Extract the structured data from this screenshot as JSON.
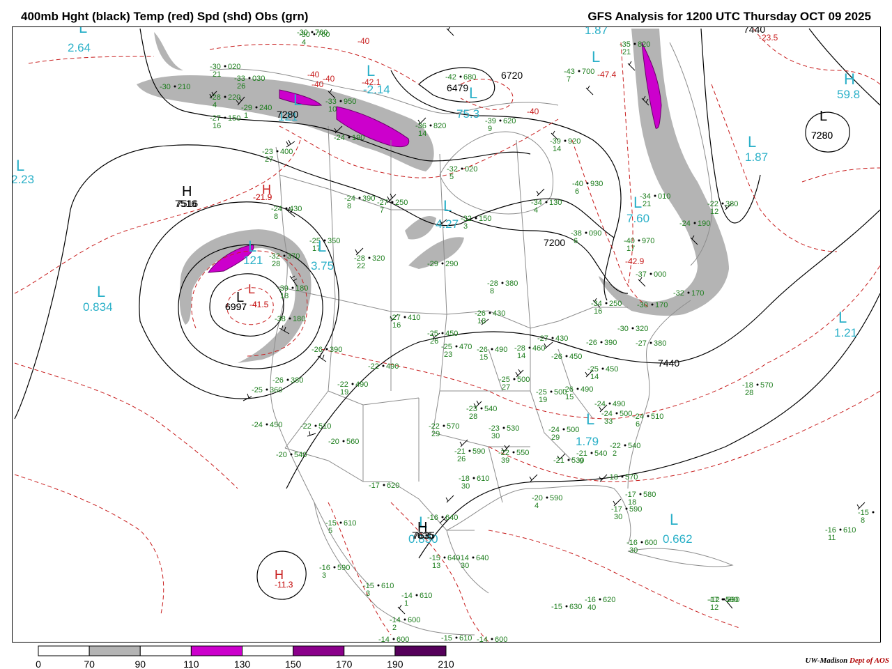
{
  "header": {
    "left_title": "400mb Hght (black) Temp (red) Spd (shd) Obs (grn)",
    "right_title": "GFS Analysis for 1200 UTC Thursday  OCT 09 2025"
  },
  "colors": {
    "height": "#000000",
    "temperature": "#c81e1e",
    "observations": "#1c7d1c",
    "pressure_centers": "#2ab0c8",
    "speed_70_90": "#b4b4b4",
    "speed_110_130": "#cc00cc",
    "speed_150_170": "#8a008a",
    "speed_190_210": "#55005a",
    "borders": "#8c8c8c"
  },
  "scale": {
    "labels": [
      "0",
      "70",
      "90",
      "110",
      "130",
      "150",
      "170",
      "190",
      "210"
    ]
  },
  "credit": {
    "org": "UW-Madison",
    "dept": "Dept of AOS"
  },
  "height_labels": [
    "7516",
    "7280",
    "6720",
    "7280",
    "6479",
    "7200",
    "6997",
    "7440",
    "7635",
    "7440"
  ],
  "temperature_labels": [
    "-40",
    "-40",
    "-40",
    "-40",
    "-40",
    "-21.9",
    "-41.5",
    "-47.4",
    "-42.9",
    "-11.3",
    "-23.5",
    "-42.1"
  ],
  "cyan_centers": [
    {
      "letter": "L",
      "value": "2.64"
    },
    {
      "letter": "L",
      "value": "2.23"
    },
    {
      "letter": "L",
      "value": "0.834"
    },
    {
      "letter": "H",
      "value": "59.8"
    },
    {
      "letter": "L",
      "value": "1.87"
    },
    {
      "letter": "L",
      "value": "1.87"
    },
    {
      "letter": "L",
      "value": "1.21"
    },
    {
      "letter": "L",
      "value": "0.662"
    },
    {
      "letter": "L",
      "value": "0.830"
    },
    {
      "letter": "L",
      "value": "1.79"
    },
    {
      "letter": "L",
      "value": "3.75"
    },
    {
      "letter": "L",
      "value": "4.27"
    },
    {
      "letter": "L",
      "value": "7.60"
    },
    {
      "letter": "L",
      "value": "121"
    },
    {
      "letter": "L",
      "value": "121"
    },
    {
      "letter": "L",
      "value": "75.3"
    },
    {
      "letter": "L",
      "value": "-2.14"
    }
  ],
  "black_centers": [
    {
      "letter": "H",
      "value": "7516"
    },
    {
      "letter": "L",
      "value": "6997"
    },
    {
      "letter": "L",
      "value": "7280"
    },
    {
      "letter": "H",
      "value": "7635"
    }
  ],
  "red_centers": [
    {
      "letter": "H",
      "value": "-21.9"
    },
    {
      "letter": "L",
      "value": "-41.5"
    },
    {
      "letter": "H",
      "value": "-11.3"
    }
  ],
  "observations": [
    {
      "t": "-30",
      "s": "21",
      "h": "020"
    },
    {
      "t": "-33",
      "s": "26",
      "h": "030"
    },
    {
      "t": "-30",
      "s": "",
      "h": "210"
    },
    {
      "t": "-28",
      "s": "4",
      "h": "220"
    },
    {
      "t": "-29",
      "s": "1",
      "h": "240"
    },
    {
      "t": "-27",
      "s": "16",
      "h": "150"
    },
    {
      "t": "-23",
      "s": "27",
      "h": "400"
    },
    {
      "t": "-24",
      "s": "8",
      "h": "390"
    },
    {
      "t": "-27",
      "s": "7",
      "h": "250"
    },
    {
      "t": "-24",
      "s": "8",
      "h": "430"
    },
    {
      "t": "-25",
      "s": "17",
      "h": "350"
    },
    {
      "t": "-28",
      "s": "22",
      "h": "320"
    },
    {
      "t": "-32",
      "s": "28",
      "h": "370"
    },
    {
      "t": "-39",
      "s": "18",
      "h": "180"
    },
    {
      "t": "-38",
      "s": "",
      "h": "180"
    },
    {
      "t": "-32",
      "s": "3",
      "h": "150"
    },
    {
      "t": "-29",
      "s": "",
      "h": "290"
    },
    {
      "t": "-28",
      "s": "8",
      "h": "380"
    },
    {
      "t": "-27",
      "s": "16",
      "h": "410"
    },
    {
      "t": "-26",
      "s": "18",
      "h": "430"
    },
    {
      "t": "-25",
      "s": "26",
      "h": "450"
    },
    {
      "t": "-25",
      "s": "23",
      "h": "470"
    },
    {
      "t": "-26",
      "s": "15",
      "h": "490"
    },
    {
      "t": "-28",
      "s": "14",
      "h": "460"
    },
    {
      "t": "-27",
      "s": "",
      "h": "430"
    },
    {
      "t": "-26",
      "s": "",
      "h": "390"
    },
    {
      "t": "-26",
      "s": "",
      "h": "390"
    },
    {
      "t": "-22",
      "s": "",
      "h": "490"
    },
    {
      "t": "-26",
      "s": "",
      "h": "380"
    },
    {
      "t": "-22",
      "s": "19",
      "h": "490"
    },
    {
      "t": "-25",
      "s": "",
      "h": "360"
    },
    {
      "t": "-24",
      "s": "",
      "h": "450"
    },
    {
      "t": "-22",
      "s": "",
      "h": "510"
    },
    {
      "t": "-20",
      "s": "",
      "h": "560"
    },
    {
      "t": "-20",
      "s": "",
      "h": "540"
    },
    {
      "t": "-22",
      "s": "29",
      "h": "570"
    },
    {
      "t": "-23",
      "s": "30",
      "h": "530"
    },
    {
      "t": "-23",
      "s": "28",
      "h": "540"
    },
    {
      "t": "-25",
      "s": "27",
      "h": "500"
    },
    {
      "t": "-25",
      "s": "19",
      "h": "500"
    },
    {
      "t": "-26",
      "s": "",
      "h": "450"
    },
    {
      "t": "-26",
      "s": "15",
      "h": "490"
    },
    {
      "t": "-24",
      "s": "29",
      "h": "500"
    },
    {
      "t": "-25",
      "s": "14",
      "h": "450"
    },
    {
      "t": "-24",
      "s": "",
      "h": "490"
    },
    {
      "t": "-24",
      "s": "33",
      "h": "500"
    },
    {
      "t": "-24",
      "s": "6",
      "h": "510"
    },
    {
      "t": "-22",
      "s": "2",
      "h": "540"
    },
    {
      "t": "-21",
      "s": "",
      "h": "530"
    },
    {
      "t": "-21",
      "s": "9",
      "h": "540"
    },
    {
      "t": "-22",
      "s": "39",
      "h": "550"
    },
    {
      "t": "-21",
      "s": "26",
      "h": "590"
    },
    {
      "t": "-18",
      "s": "30",
      "h": "610"
    },
    {
      "t": "-17",
      "s": "",
      "h": "620"
    },
    {
      "t": "-18",
      "s": "",
      "h": "570"
    },
    {
      "t": "-17",
      "s": "18",
      "h": "580"
    },
    {
      "t": "-17",
      "s": "30",
      "h": "590"
    },
    {
      "t": "-16",
      "s": "30",
      "h": "600"
    },
    {
      "t": "-20",
      "s": "4",
      "h": "590"
    },
    {
      "t": "-12",
      "s": "",
      "h": "590"
    },
    {
      "t": "-16",
      "s": "",
      "h": "640"
    },
    {
      "t": "-15",
      "s": "5",
      "h": "610"
    },
    {
      "t": "-16",
      "s": "3",
      "h": "590"
    },
    {
      "t": "-15",
      "s": "3",
      "h": "610"
    },
    {
      "t": "-15",
      "s": "13",
      "h": "640"
    },
    {
      "t": "-14",
      "s": "30",
      "h": "640"
    },
    {
      "t": "-14",
      "s": "1",
      "h": "610"
    },
    {
      "t": "-14",
      "s": "2",
      "h": "600"
    },
    {
      "t": "-14",
      "s": "",
      "h": "600"
    },
    {
      "t": "-15",
      "s": "",
      "h": "610"
    },
    {
      "t": "-14",
      "s": "",
      "h": "600"
    },
    {
      "t": "-15",
      "s": "",
      "h": "630"
    },
    {
      "t": "-16",
      "s": "40",
      "h": "620"
    },
    {
      "t": "-17",
      "s": "12",
      "h": "590"
    },
    {
      "t": "-16",
      "s": "11",
      "h": "610"
    },
    {
      "t": "-18",
      "s": "28",
      "h": "570"
    },
    {
      "t": "-27",
      "s": "",
      "h": "380"
    },
    {
      "t": "-30",
      "s": "",
      "h": "320"
    },
    {
      "t": "-32",
      "s": "",
      "h": "170"
    },
    {
      "t": "-30",
      "s": "",
      "h": "170"
    },
    {
      "t": "-34",
      "s": "16",
      "h": "250"
    },
    {
      "t": "-37",
      "s": "",
      "h": "000"
    },
    {
      "t": "-40",
      "s": "17",
      "h": "970"
    },
    {
      "t": "-38",
      "s": "6",
      "h": "090"
    },
    {
      "t": "-34",
      "s": "4",
      "h": "130"
    },
    {
      "t": "-40",
      "s": "6",
      "h": "930"
    },
    {
      "t": "-39",
      "s": "14",
      "h": "920"
    },
    {
      "t": "-34",
      "s": "21",
      "h": "010"
    },
    {
      "t": "-24",
      "s": "",
      "h": "190"
    },
    {
      "t": "-22",
      "s": "12",
      "h": "380"
    },
    {
      "t": "-32",
      "s": "5",
      "h": "020"
    },
    {
      "t": "-35",
      "s": "21",
      "h": "820"
    },
    {
      "t": "-43",
      "s": "7",
      "h": "700"
    },
    {
      "t": "-42",
      "s": "",
      "h": "680"
    },
    {
      "t": "-39",
      "s": "9",
      "h": "620"
    },
    {
      "t": "-36",
      "s": "14",
      "h": "820"
    },
    {
      "t": "-24",
      "s": "",
      "h": "190"
    },
    {
      "t": "-33",
      "s": "10",
      "h": "950"
    },
    {
      "t": "-30",
      "s": "",
      "h": "760"
    },
    {
      "t": "-30",
      "s": "4",
      "h": "760"
    },
    {
      "t": "-15",
      "s": "8",
      "h": ""
    }
  ]
}
